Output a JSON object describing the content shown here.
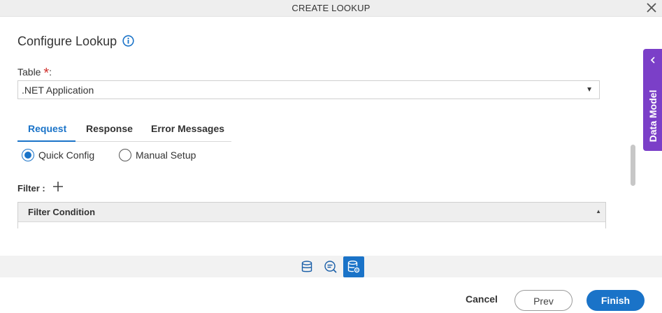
{
  "dialog": {
    "title": "CREATE LOOKUP"
  },
  "heading": "Configure Lookup",
  "table_field": {
    "label": "Table",
    "required_mark": "*",
    "suffix": ":",
    "value": ".NET Application"
  },
  "tabs": [
    {
      "label": "Request",
      "active": true
    },
    {
      "label": "Response",
      "active": false
    },
    {
      "label": "Error Messages",
      "active": false
    }
  ],
  "config_mode": {
    "options": [
      {
        "label": "Quick Config",
        "selected": true
      },
      {
        "label": "Manual Setup",
        "selected": false
      }
    ]
  },
  "filter": {
    "label": "Filter :",
    "column_header": "Filter Condition"
  },
  "side_panel": {
    "label": "Data Model"
  },
  "footer": {
    "cancel": "Cancel",
    "prev": "Prev",
    "finish": "Finish"
  },
  "icons": {
    "close": "close-icon",
    "info": "info-icon",
    "add": "plus-icon",
    "collapse": "chevron-left-icon",
    "toolbar": [
      "database-icon",
      "search-icon",
      "database-settings-icon"
    ]
  },
  "colors": {
    "accent": "#1a73c8",
    "side_panel": "#7b3fc8",
    "required": "#d0312d"
  }
}
